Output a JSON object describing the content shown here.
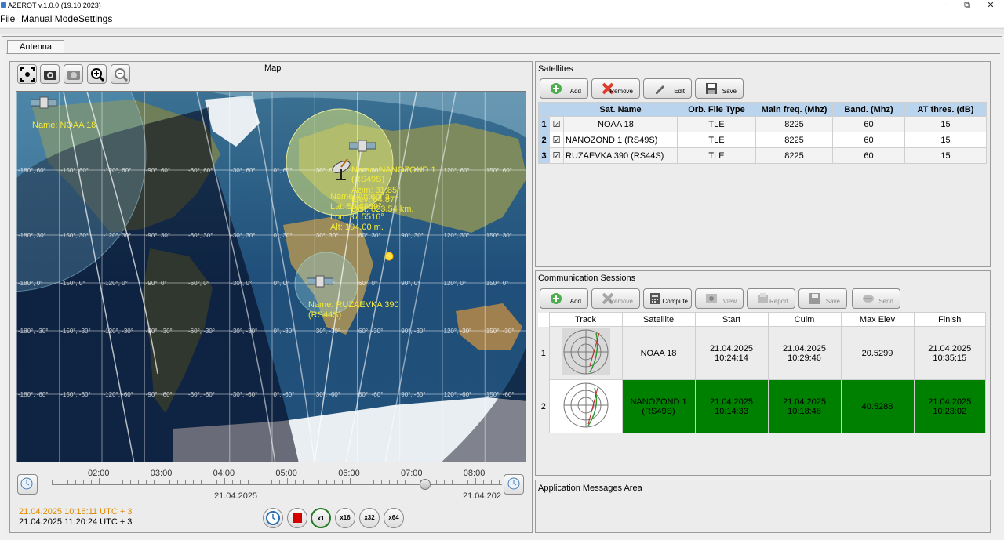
{
  "window": {
    "title": "AZEROT v.1.0.0 (19.10.2023)",
    "minimize": "−",
    "restore": "⧉",
    "close": "✕"
  },
  "menu": {
    "file": "File",
    "manual_mode": "Manual Mode",
    "settings": "Settings"
  },
  "tabs": {
    "antenna": "Antenna"
  },
  "map_panel": {
    "title": "Map",
    "tool_icons": [
      "fit-view-icon",
      "camera-icon",
      "photo-icon",
      "zoom-in-icon",
      "zoom-out-icon"
    ],
    "satellites": [
      {
        "label": "Name: NOAA 18"
      },
      {
        "label_lines": [
          "Name: NANOZOND 1",
          "(RS49S)",
          "Azim: 31.85°",
          "Elev: 64.87°",
          "Dist: 823.54 km."
        ]
      },
      {
        "label_lines": [
          "Name: RUZAEVKA 390",
          "(RS44S)"
        ]
      }
    ],
    "antenna_label": [
      "Name: Antenna",
      "Lat: 53.6989°",
      "Lon: 37.5516°",
      "Alt: 194.00 m."
    ],
    "grid_lat": [
      "60°",
      "30°",
      "0°",
      "-30°",
      "-60°"
    ],
    "grid_lon": [
      "-180°",
      "-150°",
      "-120°",
      "-90°",
      "-60°",
      "-30°",
      "0°",
      "30°",
      "60°",
      "90°",
      "120°",
      "150°"
    ]
  },
  "timeline": {
    "hours": [
      "02:00",
      "03:00",
      "04:00",
      "05:00",
      "06:00",
      "07:00",
      "08:00"
    ],
    "date_left": "21.04.2025",
    "date_right": "21.04.202",
    "position": 0.83,
    "sim_time": "21.04.2025 10:16:11 UTC + 3",
    "real_time": "21.04.2025 11:20:24 UTC + 3",
    "speed_buttons": [
      "x1",
      "x16",
      "x32",
      "x64"
    ],
    "colors": {
      "sim_time": "#e08a00",
      "active_speed": "#1f7a1f",
      "stop": "#d40000"
    }
  },
  "satellites_panel": {
    "title": "Satellites",
    "buttons": {
      "add": "Add",
      "remove": "Remove",
      "edit": "Edit",
      "save": "Save"
    },
    "columns": [
      "Sat. Name",
      "Orb. File Type",
      "Main freq. (Mhz)",
      "Band. (Mhz)",
      "AT thres. (dB)"
    ],
    "rows": [
      {
        "index": "1",
        "checked": true,
        "name": "NOAA 18",
        "file_type": "TLE",
        "freq": "8225",
        "band": "60",
        "thres": "15"
      },
      {
        "index": "2",
        "checked": true,
        "name": "NANOZOND 1 (RS49S)",
        "file_type": "TLE",
        "freq": "8225",
        "band": "60",
        "thres": "15"
      },
      {
        "index": "3",
        "checked": true,
        "name": "RUZAEVKA 390 (RS44S)",
        "file_type": "TLE",
        "freq": "8225",
        "band": "60",
        "thres": "15"
      }
    ],
    "header_color": "#b9d4ec"
  },
  "sessions_panel": {
    "title": "Communication Sessions",
    "buttons": {
      "add": "Add",
      "remove": "Remove",
      "compute": "Compute",
      "view": "View",
      "report": "Report",
      "save": "Save",
      "send": "Send"
    },
    "columns": [
      "Track",
      "Satellite",
      "Start",
      "Culm",
      "Max Elev",
      "Finish"
    ],
    "rows": [
      {
        "index": "1",
        "satellite": "NOAA 18",
        "start": [
          "21.04.2025",
          "10:24:14"
        ],
        "culm": [
          "21.04.2025",
          "10:29:46"
        ],
        "max_elev": "20.5299",
        "finish": [
          "21.04.2025",
          "10:35:15"
        ],
        "active": false
      },
      {
        "index": "2",
        "satellite": [
          "NANOZOND 1",
          "(RS49S)"
        ],
        "start": [
          "21.04.2025",
          "10:14:33"
        ],
        "culm": [
          "21.04.2025",
          "10:18:48"
        ],
        "max_elev": "40.5288",
        "finish": [
          "21.04.2025",
          "10:23:02"
        ],
        "active": true
      }
    ],
    "active_color": "#008000"
  },
  "messages_panel": {
    "title": "Application Messages Area"
  }
}
